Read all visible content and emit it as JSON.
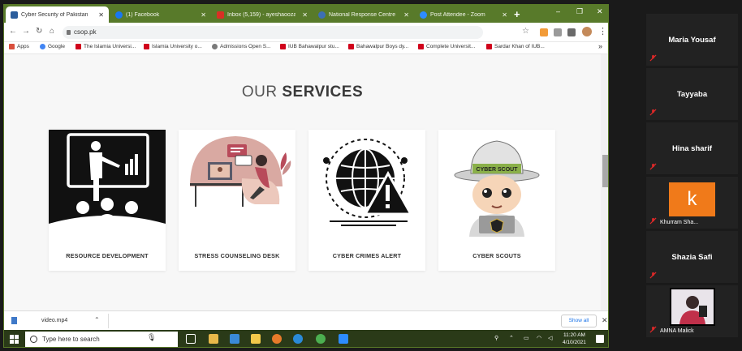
{
  "browser": {
    "tabs": [
      {
        "label": "Cyber Security of Pakistan",
        "favicon_color": "#2b5d9c"
      },
      {
        "label": "(1) Facebook",
        "favicon_color": "#1877f2"
      },
      {
        "label": "Inbox (5,159) - ayeshaoozaqil",
        "favicon_color": "#d93025"
      },
      {
        "label": "National Response Centre For",
        "favicon_color": "#3c6fb5"
      },
      {
        "label": "Post Attendee - Zoom",
        "favicon_color": "#2d8cff"
      }
    ],
    "new_tab": "+",
    "window_controls": [
      "–",
      "❐",
      "✕"
    ],
    "address": "csop.pk",
    "bookmarks": [
      {
        "label": "Apps",
        "color": "#d94f3d"
      },
      {
        "label": "Google",
        "color": "#4285f4"
      },
      {
        "label": "The Islamia Universi...",
        "color": "#d0021b"
      },
      {
        "label": "Islamia University o...",
        "color": "#d0021b"
      },
      {
        "label": "Admissions Open S...",
        "color": "#7a7a7a"
      },
      {
        "label": "IUB Bahawalpur stu...",
        "color": "#d0021b"
      },
      {
        "label": "Bahawalpur Boys dy...",
        "color": "#d0021b"
      },
      {
        "label": "Complete Universit...",
        "color": "#d0021b"
      },
      {
        "label": "Sardar Khan of IUB...",
        "color": "#d0021b"
      }
    ],
    "bookmarks_more": "»"
  },
  "page": {
    "heading_light": "OUR ",
    "heading_bold": "SERVICES",
    "cards": [
      {
        "title": "RESOURCE DEVELOPMENT"
      },
      {
        "title": "STRESS COUNSELING DESK"
      },
      {
        "title": "CYBER CRIMES ALERT"
      },
      {
        "title": "CYBER SCOUTS"
      }
    ],
    "scout_hat_text": "CYBER  SCOUT"
  },
  "downloads": {
    "file_name": "video.mp4",
    "show_all": "Show all",
    "close": "✕"
  },
  "taskbar": {
    "search_placeholder": "Type here to search",
    "time": "11:20 AM",
    "date": "4/10/2021",
    "notifications": "2"
  },
  "participants": [
    {
      "name": "Maria Yousaf",
      "display": "center"
    },
    {
      "name": "Tayyaba",
      "display": "center"
    },
    {
      "name": "Hina sharif",
      "display": "center"
    },
    {
      "name": "Khurram Sha...",
      "display": "avatar",
      "initial": "k"
    },
    {
      "name": "Shazia Safi",
      "display": "center"
    },
    {
      "name": "AMNA Malick",
      "display": "photo"
    }
  ],
  "colors": {
    "tab_strip": "#587a2a",
    "taskbar": "#2a3a18",
    "zoom_bg": "#1a1a1a",
    "avatar_orange": "#f07a1a",
    "muted_red": "#e02828"
  }
}
